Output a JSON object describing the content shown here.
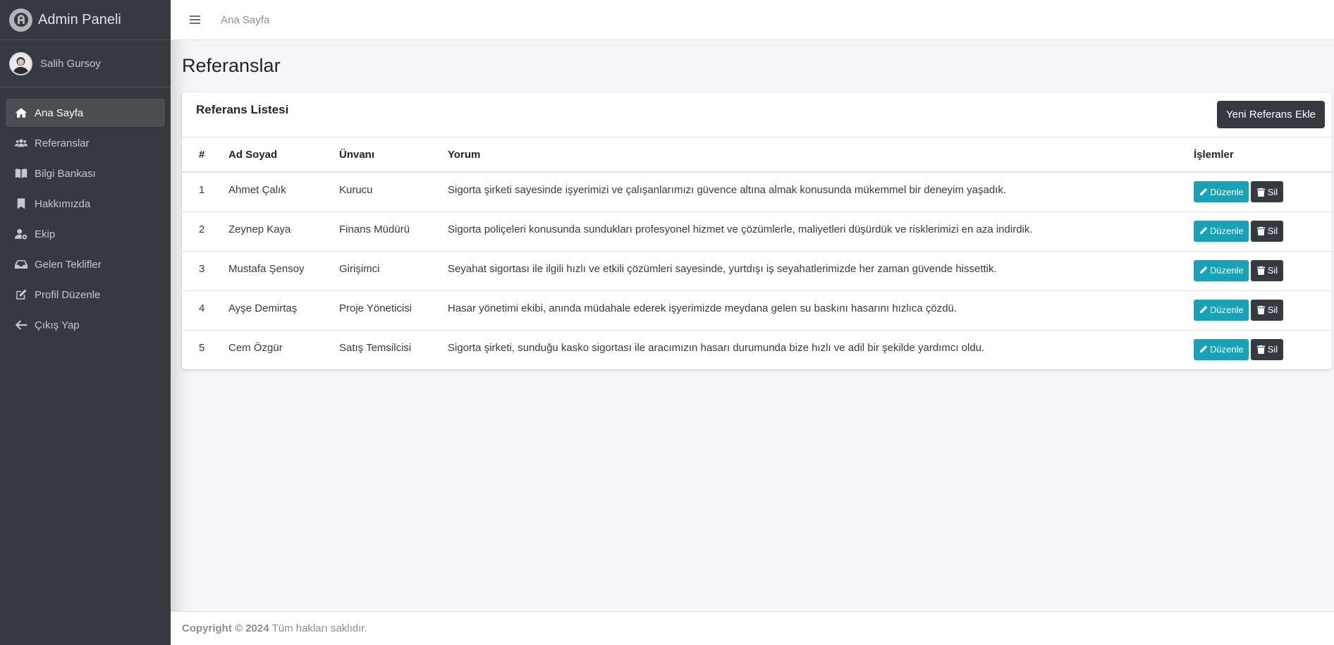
{
  "brand": {
    "title": "Admin Paneli"
  },
  "user": {
    "name": "Salih Gursoy"
  },
  "sidebar": {
    "items": [
      {
        "label": "Ana Sayfa",
        "icon": "home-icon",
        "active": true
      },
      {
        "label": "Referanslar",
        "icon": "users-icon",
        "active": false
      },
      {
        "label": "Bilgi Bankası",
        "icon": "book-icon",
        "active": false
      },
      {
        "label": "Hakkımızda",
        "icon": "bookmark-icon",
        "active": false
      },
      {
        "label": "Ekip",
        "icon": "user-cog-icon",
        "active": false
      },
      {
        "label": "Gelen Teklifler",
        "icon": "inbox-icon",
        "active": false
      },
      {
        "label": "Profil Düzenle",
        "icon": "edit-icon",
        "active": false
      },
      {
        "label": "Çıkış Yap",
        "icon": "arrow-left-icon",
        "active": false
      }
    ]
  },
  "topbar": {
    "breadcrumb": "Ana Sayfa"
  },
  "page": {
    "title": "Referanslar"
  },
  "card": {
    "title": "Referans Listesi",
    "add_button": "Yeni Referans Ekle"
  },
  "table": {
    "headers": {
      "num": "#",
      "name": "Ad Soyad",
      "title": "Ünvanı",
      "comment": "Yorum",
      "actions": "İşlemler"
    },
    "edit_label": "Düzenle",
    "delete_label": "Sil",
    "rows": [
      {
        "num": "1",
        "name": "Ahmet Çalık",
        "title": "Kurucu",
        "comment": "Sigorta şirketi sayesinde işyerimizi ve çalışanlarımızı güvence altına almak konusunda mükemmel bir deneyim yaşadık."
      },
      {
        "num": "2",
        "name": "Zeynep Kaya",
        "title": "Finans Müdürü",
        "comment": "Sigorta poliçeleri konusunda sundukları profesyonel hizmet ve çözümlerle, maliyetleri düşürdük ve risklerimizi en aza indirdik."
      },
      {
        "num": "3",
        "name": "Mustafa Şensoy",
        "title": "Girişimci",
        "comment": "Seyahat sigortası ile ilgili hızlı ve etkili çözümleri sayesinde, yurtdışı iş seyahatlerimizde her zaman güvende hissettik."
      },
      {
        "num": "4",
        "name": "Ayşe Demirtaş",
        "title": "Proje Yöneticisi",
        "comment": "Hasar yönetimi ekibi, anında müdahale ederek işyerimizde meydana gelen su baskını hasarını hızlıca çözdü."
      },
      {
        "num": "5",
        "name": "Cem Özgür",
        "title": "Satış Temsilcisi",
        "comment": "Sigorta şirketi, sunduğu kasko sigortası ile aracımızın hasarı durumunda bize hızlı ve adil bir şekilde yardımcı oldu."
      }
    ]
  },
  "footer": {
    "copyright": "Copyright © 2024",
    "rights": "Tüm hakları saklıdır."
  },
  "colors": {
    "sidebar_bg": "#343a40",
    "edit_button": "#17a2b8",
    "delete_button": "#343a40",
    "content_bg": "#f4f6f9"
  }
}
